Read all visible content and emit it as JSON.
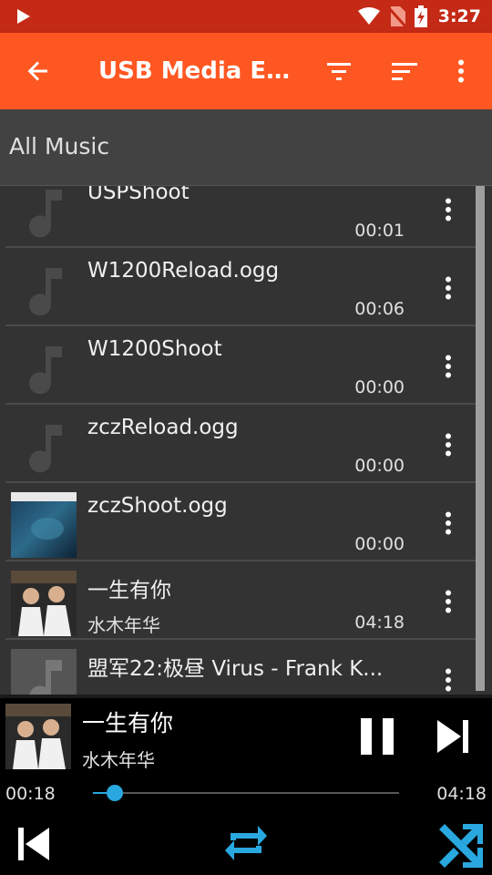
{
  "status_bar": {
    "time": "3:27"
  },
  "app_bar": {
    "title": "USB Media Explorer"
  },
  "section": {
    "title": "All Music"
  },
  "tracks": [
    {
      "name": "USPShoot",
      "artist": "",
      "duration": "00:01",
      "art": "music-note-icon"
    },
    {
      "name": "W1200Reload.ogg",
      "artist": "",
      "duration": "00:06",
      "art": "music-note-icon"
    },
    {
      "name": "W1200Shoot",
      "artist": "",
      "duration": "00:00",
      "art": "music-note-icon"
    },
    {
      "name": "zczReload.ogg",
      "artist": "",
      "duration": "00:00",
      "art": "music-note-icon"
    },
    {
      "name": "zczShoot.ogg",
      "artist": "",
      "duration": "00:00",
      "art": "album-cover-blue"
    },
    {
      "name": "一生有你",
      "artist": "水木年华",
      "duration": "04:18",
      "art": "album-cover-duo"
    },
    {
      "name": "盟军22:极昼 Virus - Frank K...",
      "artist": "",
      "duration": "",
      "art": "album-cover-grey"
    }
  ],
  "player": {
    "song": "一生有你",
    "artist": "水木年华",
    "current_time": "00:18",
    "total_time": "04:18",
    "progress": 0.07
  },
  "colors": {
    "accent": "#ff5722",
    "status": "#c42a16",
    "seek": "#29a8e0"
  }
}
